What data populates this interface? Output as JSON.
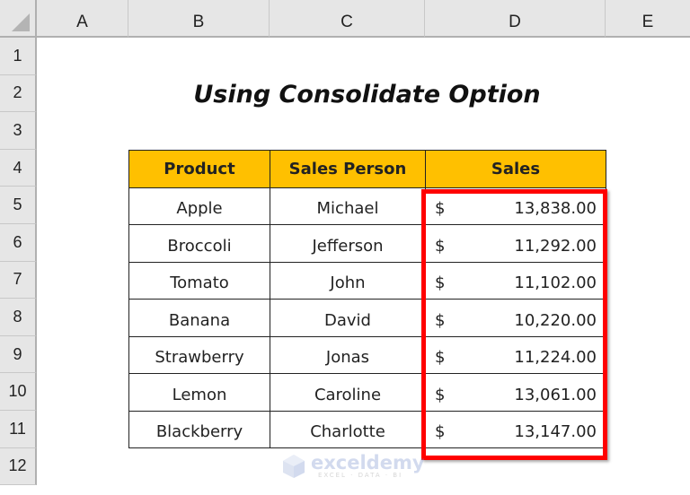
{
  "columns": [
    "A",
    "B",
    "C",
    "D",
    "E"
  ],
  "rows": [
    "1",
    "2",
    "3",
    "4",
    "5",
    "6",
    "7",
    "8",
    "9",
    "10",
    "11",
    "12"
  ],
  "title": "Using Consolidate Option",
  "table": {
    "headers": [
      "Product",
      "Sales Person",
      "Sales"
    ],
    "rows": [
      {
        "product": "Apple",
        "person": "Michael",
        "currency": "$",
        "sales": "13,838.00"
      },
      {
        "product": "Broccoli",
        "person": "Jefferson",
        "currency": "$",
        "sales": "11,292.00"
      },
      {
        "product": "Tomato",
        "person": "John",
        "currency": "$",
        "sales": "11,102.00"
      },
      {
        "product": "Banana",
        "person": "David",
        "currency": "$",
        "sales": "10,220.00"
      },
      {
        "product": "Strawberry",
        "person": "Jonas",
        "currency": "$",
        "sales": "11,224.00"
      },
      {
        "product": "Lemon",
        "person": "Caroline",
        "currency": "$",
        "sales": "13,061.00"
      },
      {
        "product": "Blackberry",
        "person": "Charlotte",
        "currency": "$",
        "sales": "13,147.00"
      }
    ]
  },
  "colors": {
    "header_fill": "#ffc000",
    "highlight": "#ff0000"
  },
  "watermark": {
    "brand": "exceldemy",
    "tagline": "EXCEL · DATA · BI"
  }
}
